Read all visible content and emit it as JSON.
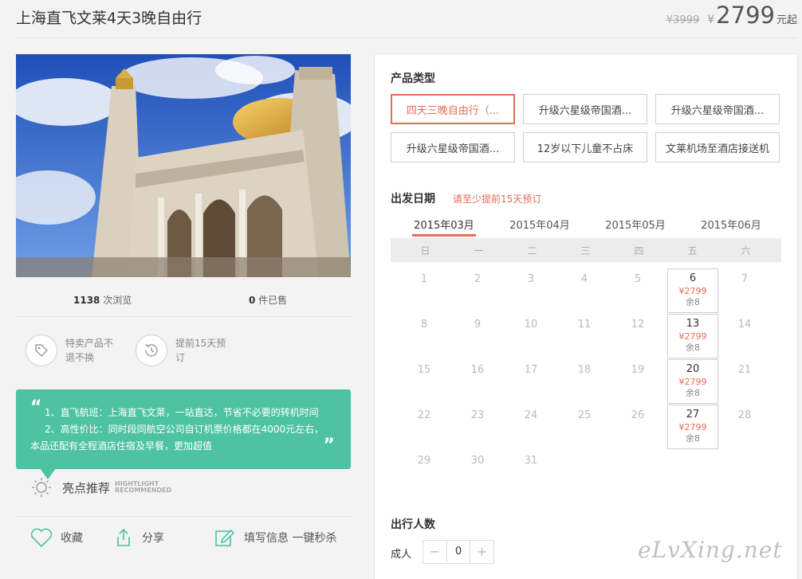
{
  "header": {
    "title": "上海直飞文莱4天3晚自由行",
    "old_price": "¥3999",
    "yen": "¥",
    "price": "2799",
    "price_suffix": "元起"
  },
  "stats": {
    "views_count": "1138",
    "views_label": " 次浏览",
    "sold_count": "0",
    "sold_label": " 件已售"
  },
  "badges": [
    {
      "icon": "tag-icon",
      "text": "特卖产品不退不换"
    },
    {
      "icon": "clock-history-icon",
      "text": "提前15天预订"
    }
  ],
  "highlights": {
    "quote_open": "“",
    "quote_close": "”",
    "lines": [
      "1、直飞航班：上海直飞文莱，一站直达，节省不必要的转机时间",
      "2、高性价比：同时段同航空公司自订机票价格都在4000元左右，",
      "本品还配有全程酒店住宿及早餐，更加超值"
    ],
    "label": "亮点推荐",
    "label_en_1": "HIGHTLIGHT",
    "label_en_2": "RECOMMENDED"
  },
  "actions": {
    "favorite": "收藏",
    "share": "分享",
    "fill_info": "填写信息 一键秒杀"
  },
  "product_type": {
    "title": "产品类型",
    "options": [
      "四天三晚自由行（...",
      "升级六星级帝国酒...",
      "升级六星级帝国酒...",
      "升级六星级帝国酒...",
      "12岁以下儿童不占床",
      "文莱机场至酒店接送机"
    ],
    "selected_index": 0
  },
  "departure": {
    "title": "出发日期",
    "note": "请至少提前15天预订",
    "months": [
      "2015年03月",
      "2015年04月",
      "2015年05月",
      "2015年06月"
    ],
    "active_month": 0,
    "weekdays": [
      "日",
      "一",
      "二",
      "三",
      "四",
      "五",
      "六"
    ],
    "weeks": [
      [
        {
          "d": "1"
        },
        {
          "d": "2"
        },
        {
          "d": "3"
        },
        {
          "d": "4"
        },
        {
          "d": "5"
        },
        {
          "d": "6",
          "p": "¥2799",
          "l": "余8"
        },
        {
          "d": "7"
        }
      ],
      [
        {
          "d": "8"
        },
        {
          "d": "9"
        },
        {
          "d": "10"
        },
        {
          "d": "11"
        },
        {
          "d": "12"
        },
        {
          "d": "13",
          "p": "¥2799",
          "l": "余8"
        },
        {
          "d": "14"
        }
      ],
      [
        {
          "d": "15"
        },
        {
          "d": "16"
        },
        {
          "d": "17"
        },
        {
          "d": "18"
        },
        {
          "d": "19"
        },
        {
          "d": "20",
          "p": "¥2799",
          "l": "余8"
        },
        {
          "d": "21"
        }
      ],
      [
        {
          "d": "22"
        },
        {
          "d": "23"
        },
        {
          "d": "24"
        },
        {
          "d": "25"
        },
        {
          "d": "26"
        },
        {
          "d": "27",
          "p": "¥2799",
          "l": "余8"
        },
        {
          "d": "28"
        }
      ],
      [
        {
          "d": "29"
        },
        {
          "d": "30"
        },
        {
          "d": "31"
        }
      ]
    ]
  },
  "travelers": {
    "title": "出行人数",
    "adult_label": "成人",
    "minus": "−",
    "plus": "+",
    "adult_count": "0"
  },
  "watermark": "eLvXing.net"
}
